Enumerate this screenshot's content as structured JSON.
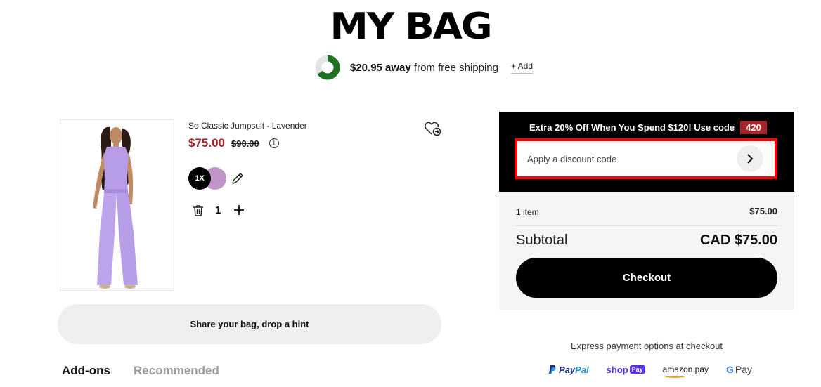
{
  "header": {
    "title": "MY BAG"
  },
  "shipping": {
    "amount": "$20.95 away",
    "rest": " from free shipping",
    "add_label": "+ Add",
    "progress_fraction": 0.65,
    "progress_color": "#1f6f20"
  },
  "product": {
    "name": "So Classic Jumpsuit - Lavender",
    "price": "$75.00",
    "original_price": "$90.00",
    "quantity_badge": "1X",
    "swatch_color": "#c195c9",
    "quantity": "1",
    "info_glyph": "i",
    "icons": [
      "wishlist-heart-icon",
      "info-icon",
      "edit-pencil-icon",
      "trash-icon",
      "plus-icon"
    ]
  },
  "share": {
    "label": "Share your bag, drop a hint"
  },
  "tabs": [
    {
      "label": "Add-ons",
      "active": true
    },
    {
      "label": "Recommended",
      "active": false
    }
  ],
  "promo": {
    "text": "Extra 20% Off When You Spend $120! Use code",
    "code": "420",
    "code_color": "#a8232a",
    "discount_placeholder": "Apply a discount code"
  },
  "summary": {
    "items_label": "1 item",
    "items_price": "$75.00",
    "subtotal_label": "Subtotal",
    "subtotal_value": "CAD $75.00",
    "checkout_label": "Checkout"
  },
  "express": {
    "label": "Express payment options at checkout",
    "methods": [
      {
        "part1": "Pay",
        "part2": "Pal"
      },
      {
        "name": "shop",
        "tag": "Pay"
      },
      {
        "name": "amazon pay"
      },
      {
        "g": "G",
        "name": "Pay"
      }
    ]
  }
}
